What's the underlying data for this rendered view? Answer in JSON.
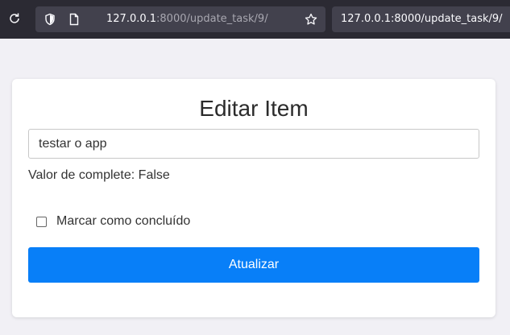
{
  "browser": {
    "url_host": "127.0.0.1",
    "url_rest": ":8000/update_task/9/",
    "search_text": "127.0.0.1:8000/update_task/9/",
    "icons": [
      "reload-icon",
      "shield-icon",
      "page-icon",
      "star-icon"
    ]
  },
  "form": {
    "title": "Editar Item",
    "input_value": "testar o app",
    "status_text": "Valor de complete: False",
    "checkbox_label": "Marcar como concluído",
    "checkbox_checked": false,
    "submit_label": "Atualizar"
  },
  "colors": {
    "primary": "#087ff8",
    "background": "#f1f0f5",
    "browser_chrome": "#2b2a33"
  }
}
